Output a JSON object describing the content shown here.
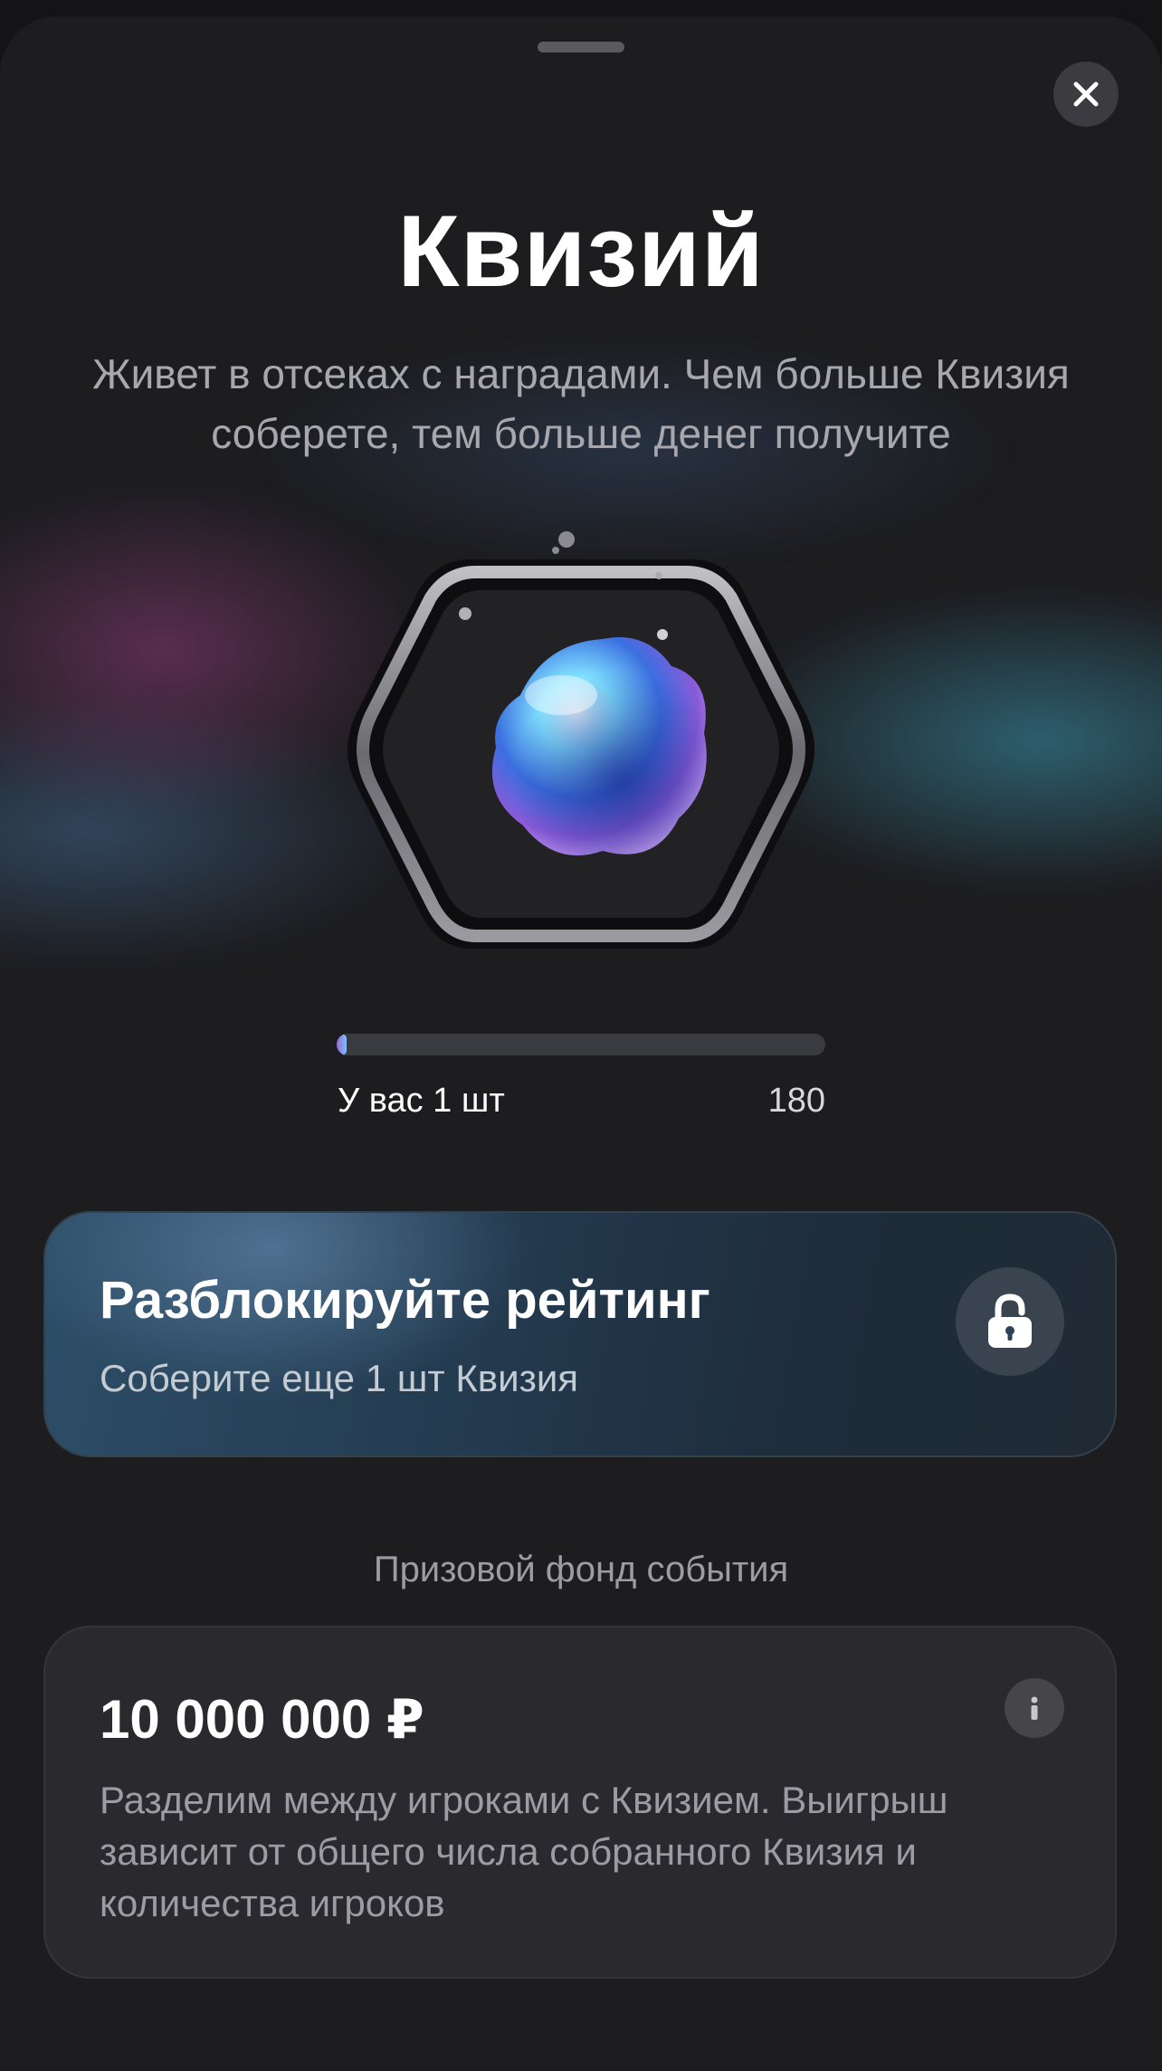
{
  "header": {
    "title": "Квизий",
    "subtitle": "Живет в отсеках с наградами. Чем больше Квизия соберете, тем больше денег получите"
  },
  "icons": {
    "close": "close-icon",
    "lock": "lock-icon",
    "info": "info-icon",
    "item": "quizium-crystal-icon"
  },
  "progress": {
    "current_label": "У вас 1 шт",
    "max_label": "180",
    "current": 1,
    "max": 180
  },
  "unlock_card": {
    "title": "Разблокируйте рейтинг",
    "subtitle": "Соберите еще 1 шт Квизия"
  },
  "prize": {
    "heading": "Призовой фонд события",
    "amount": "10 000 000 ₽",
    "description": "Разделим между игроками с Квизием. Выигрыш зависит от общего числа собранного Квизия и количества игроков"
  },
  "colors": {
    "background": "#1d1d20",
    "accent_gradient_start": "#9a6ad0",
    "accent_gradient_end": "#7cc0ff",
    "unlock_card": "#243b50",
    "prize_card": "#2a2a2e"
  }
}
